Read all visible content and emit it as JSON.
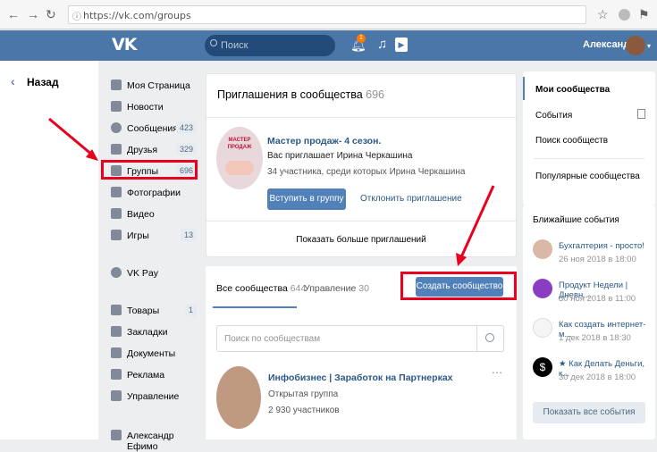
{
  "browser": {
    "url": "https://vk.com/groups"
  },
  "header": {
    "logo": "VK",
    "search_placeholder": "Поиск",
    "notif_count": "1",
    "user_name": "Александр"
  },
  "back_label": "Назад",
  "menu": [
    {
      "label": "Моя Страница",
      "count": ""
    },
    {
      "label": "Новости",
      "count": ""
    },
    {
      "label": "Сообщения",
      "count": "423"
    },
    {
      "label": "Друзья",
      "count": "329"
    },
    {
      "label": "Группы",
      "count": "696"
    },
    {
      "label": "Фотографии",
      "count": ""
    },
    {
      "label": "Видео",
      "count": ""
    },
    {
      "label": "Игры",
      "count": "13"
    },
    {
      "label": "VK Pay",
      "count": ""
    },
    {
      "label": "Товары",
      "count": "1"
    },
    {
      "label": "Закладки",
      "count": ""
    },
    {
      "label": "Документы",
      "count": ""
    },
    {
      "label": "Реклама",
      "count": ""
    },
    {
      "label": "Управление",
      "count": ""
    },
    {
      "label": "Александр Ефимо",
      "count": ""
    }
  ],
  "invites": {
    "title": "Приглашения в сообщества",
    "count": "696",
    "item_title": "Мастер продаж- 4 сезон.",
    "inviter": "Вас приглашает Ирина Черкашина",
    "members": "34 участника, среди которых Ирина Черкашина",
    "join_label": "Вступить в группу",
    "decline_label": "Отклонить приглашение",
    "more_label": "Показать больше приглашений",
    "logo_lines": [
      "МАСТЕР",
      "ПРОДАЖ"
    ]
  },
  "tabs": {
    "all_label": "Все сообщества",
    "all_count": "644",
    "manage_label": "Управление",
    "manage_count": "30",
    "create_label": "Создать сообщество"
  },
  "community_search_placeholder": "Поиск по сообществам",
  "community": {
    "name": "Инфобизнес | Заработок на Партнерках",
    "type": "Открытая группа",
    "members": "2 930 участников"
  },
  "right_menu": [
    "Мои сообщества",
    "События",
    "Поиск сообществ",
    "Популярные сообщества"
  ],
  "events": {
    "title": "Ближайшие события",
    "items": [
      {
        "title": "Бухгалтерия - просто!",
        "date": "26 ноя 2018 в 18:00"
      },
      {
        "title": "Продукт Недели | Дневн...",
        "date": "30 ноя 2018 в 11:00"
      },
      {
        "title": "Как создать интернет-м...",
        "date": "1 дек 2018 в 18:30"
      },
      {
        "title": "★ Как Делать Деньги, к...",
        "date": "30 дек 2018 в 18:00"
      }
    ],
    "show_all": "Показать все события"
  },
  "colors": {
    "vk_blue": "#4a76a8",
    "button_blue": "#5181b8",
    "link": "#2a5885",
    "annotation_red": "#e8001e"
  }
}
